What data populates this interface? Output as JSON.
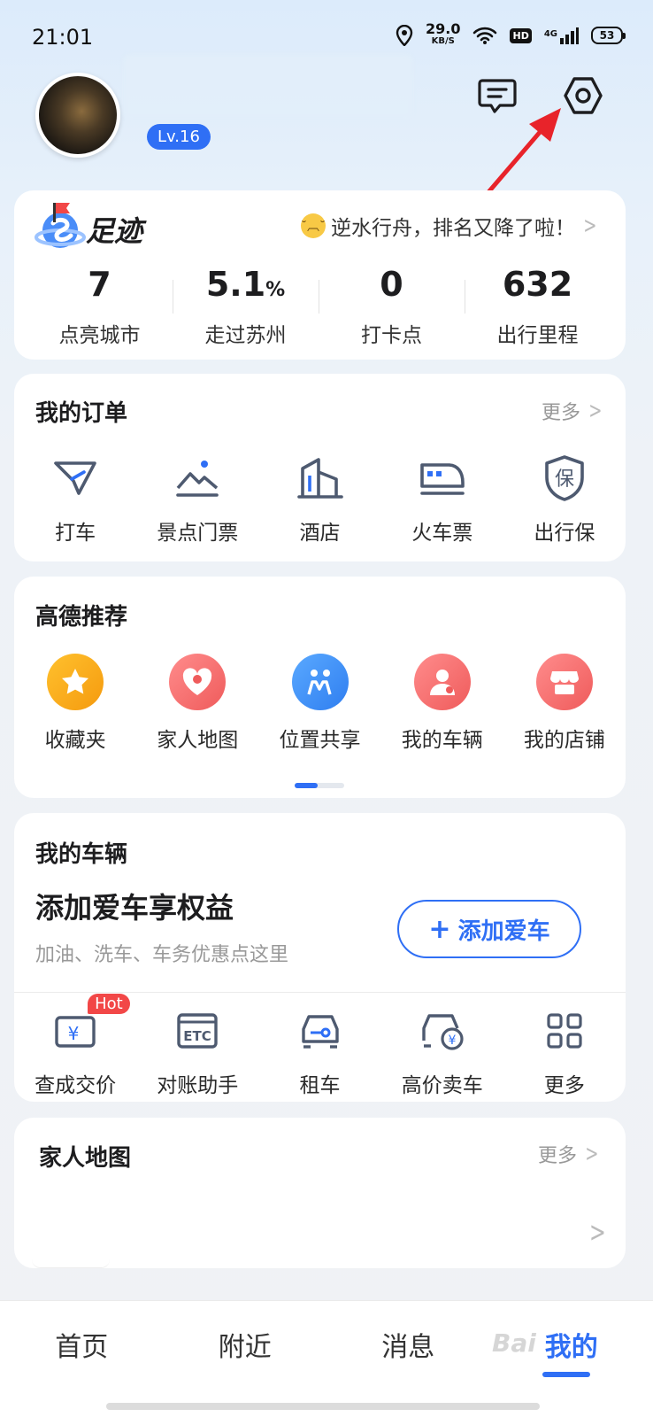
{
  "status_bar": {
    "time": "21:01",
    "net_speed_value": "29.0",
    "net_speed_unit": "KB/S",
    "hd_badge": "HD",
    "signal_label": "4G",
    "battery": "53"
  },
  "header": {
    "level": "Lv.16"
  },
  "footprint": {
    "title": "足迹",
    "slogan": "逆水行舟，排名又降了啦！",
    "stats": [
      {
        "value": "7",
        "unit": "",
        "label": "点亮城市"
      },
      {
        "value": "5.1",
        "unit": "%",
        "label": "走过苏州"
      },
      {
        "value": "0",
        "unit": "",
        "label": "打卡点"
      },
      {
        "value": "632",
        "unit": "",
        "label": "出行里程"
      }
    ]
  },
  "orders": {
    "title": "我的订单",
    "more": "更多",
    "items": [
      {
        "label": "打车",
        "icon": "taxi-icon"
      },
      {
        "label": "景点门票",
        "icon": "scenic-ticket-icon"
      },
      {
        "label": "酒店",
        "icon": "hotel-icon"
      },
      {
        "label": "火车票",
        "icon": "train-icon"
      },
      {
        "label": "出行保",
        "icon": "insurance-icon"
      }
    ]
  },
  "recommend": {
    "title": "高德推荐",
    "items": [
      {
        "label": "收藏夹",
        "icon": "star-icon",
        "color": "#f7a21b"
      },
      {
        "label": "家人地图",
        "icon": "heart-icon",
        "color": "#f26a6a"
      },
      {
        "label": "位置共享",
        "icon": "people-icon",
        "color": "#3a8ff0"
      },
      {
        "label": "我的车辆",
        "icon": "person-icon",
        "color": "#f26a6a"
      },
      {
        "label": "我的店铺",
        "icon": "shop-icon",
        "color": "#f26a6a"
      }
    ]
  },
  "vehicle": {
    "title": "我的车辆",
    "headline": "添加爱车享权益",
    "subtitle": "加油、洗车、车务优惠点这里",
    "add_button": "添加爱车",
    "add_button_icon": "+",
    "hot_badge": "Hot",
    "items": [
      {
        "label": "查成交价",
        "icon": "price-icon"
      },
      {
        "label": "对账助手",
        "icon": "etc-icon",
        "icon_text": "ETC"
      },
      {
        "label": "租车",
        "icon": "rent-car-icon"
      },
      {
        "label": "高价卖车",
        "icon": "sell-car-icon"
      },
      {
        "label": "更多",
        "icon": "grid-icon"
      }
    ]
  },
  "family_map": {
    "title": "家人地图",
    "more": "更多"
  },
  "bottom_nav": {
    "items": [
      "首页",
      "附近",
      "消息",
      "我的"
    ],
    "active_index": 3
  },
  "colors": {
    "accent": "#2f6ff5",
    "annotation_arrow": "#e8232a"
  },
  "watermark": "Bai"
}
